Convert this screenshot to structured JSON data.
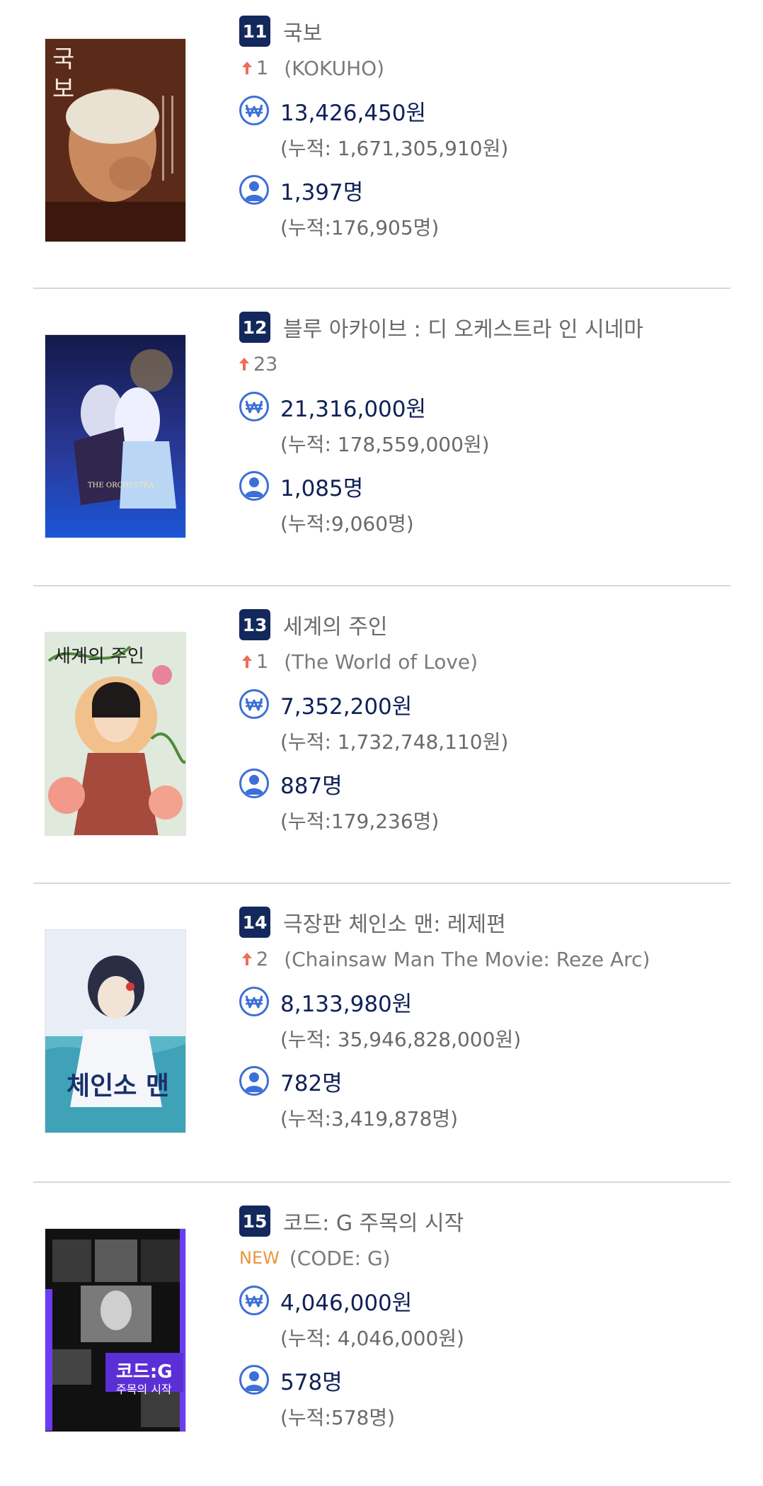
{
  "movies": [
    {
      "rank": "11",
      "title": "국보",
      "change": "1",
      "change_type": "up",
      "original_title": "(KOKUHO)",
      "sales": "13,426,450원",
      "sales_cum": "(누적: 1,671,305,910원)",
      "audience": "1,397명",
      "audience_cum": "(누적:176,905명)"
    },
    {
      "rank": "12",
      "title": "블루 아카이브 : 디 오케스트라 인 시네마",
      "change": "23",
      "change_type": "up",
      "original_title": "",
      "sales": "21,316,000원",
      "sales_cum": "(누적: 178,559,000원)",
      "audience": "1,085명",
      "audience_cum": "(누적:9,060명)"
    },
    {
      "rank": "13",
      "title": "세계의 주인",
      "change": "1",
      "change_type": "up",
      "original_title": "(The World of Love)",
      "sales": "7,352,200원",
      "sales_cum": "(누적: 1,732,748,110원)",
      "audience": "887명",
      "audience_cum": "(누적:179,236명)"
    },
    {
      "rank": "14",
      "title": "극장판 체인소 맨: 레제편",
      "change": "2",
      "change_type": "up",
      "original_title": "(Chainsaw Man The Movie: Reze Arc)",
      "sales": "8,133,980원",
      "sales_cum": "(누적: 35,946,828,000원)",
      "audience": "782명",
      "audience_cum": "(누적:3,419,878명)"
    },
    {
      "rank": "15",
      "title": "코드: G 주목의 시작",
      "change": "NEW",
      "change_type": "new",
      "original_title": "(CODE: G)",
      "sales": "4,046,000원",
      "sales_cum": "(누적: 4,046,000원)",
      "audience": "578명",
      "audience_cum": "(누적:578명)"
    }
  ],
  "icons": {
    "sales": "won-currency-icon",
    "audience": "person-icon",
    "up": "arrow-up-icon"
  },
  "colors": {
    "rank_badge": "#13285c",
    "value_text": "#0f2157",
    "icon_blue": "#3d6fd8",
    "arrow_up": "#f06b5a",
    "new_badge": "#e8963a"
  }
}
